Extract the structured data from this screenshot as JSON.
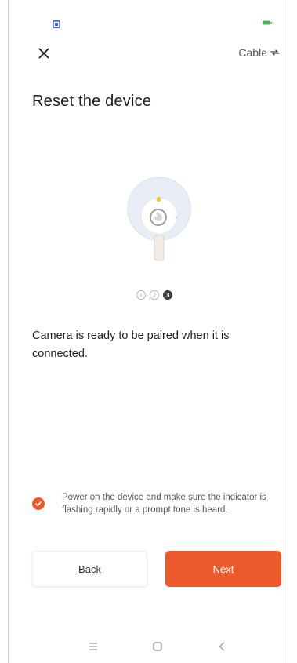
{
  "status_bar": {
    "left_icon": "app-notification-icon",
    "right_icon": "battery-icon",
    "colors": {
      "notification": "#3a5fcd",
      "battery": "#44b65a"
    }
  },
  "header": {
    "close_icon": "close-icon",
    "mode_label": "Cable",
    "mode_icon": "cable-icon"
  },
  "page": {
    "title": "Reset the device"
  },
  "illustration": {
    "icon": "camera-icon",
    "indicator_color": "#f0c43b"
  },
  "steps": {
    "items": [
      "1",
      "2",
      "3"
    ],
    "current": 3
  },
  "description": "Camera is ready to be paired when it is connected.",
  "confirm": {
    "checked": true,
    "text": "Power on the device and make sure the indicator is flashing rapidly or a prompt tone is heard."
  },
  "buttons": {
    "back_label": "Back",
    "next_label": "Next"
  },
  "colors": {
    "accent": "#ea5a2b"
  },
  "nav_bar": {
    "menu_icon": "menu-icon",
    "home_icon": "home-icon",
    "back_icon": "back-icon"
  }
}
